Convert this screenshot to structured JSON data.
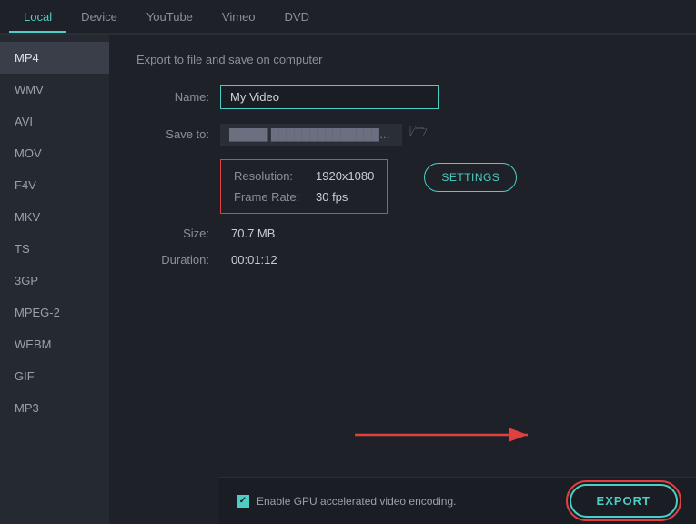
{
  "nav": {
    "tabs": [
      {
        "id": "local",
        "label": "Local",
        "active": true
      },
      {
        "id": "device",
        "label": "Device",
        "active": false
      },
      {
        "id": "youtube",
        "label": "YouTube",
        "active": false
      },
      {
        "id": "vimeo",
        "label": "Vimeo",
        "active": false
      },
      {
        "id": "dvd",
        "label": "DVD",
        "active": false
      }
    ]
  },
  "sidebar": {
    "formats": [
      {
        "id": "mp4",
        "label": "MP4",
        "active": true
      },
      {
        "id": "wmv",
        "label": "WMV",
        "active": false
      },
      {
        "id": "avi",
        "label": "AVI",
        "active": false
      },
      {
        "id": "mov",
        "label": "MOV",
        "active": false
      },
      {
        "id": "f4v",
        "label": "F4V",
        "active": false
      },
      {
        "id": "mkv",
        "label": "MKV",
        "active": false
      },
      {
        "id": "ts",
        "label": "TS",
        "active": false
      },
      {
        "id": "3gp",
        "label": "3GP",
        "active": false
      },
      {
        "id": "mpeg2",
        "label": "MPEG-2",
        "active": false
      },
      {
        "id": "webm",
        "label": "WEBM",
        "active": false
      },
      {
        "id": "gif",
        "label": "GIF",
        "active": false
      },
      {
        "id": "mp3",
        "label": "MP3",
        "active": false
      }
    ]
  },
  "content": {
    "section_title": "Export to file and save on computer",
    "name_label": "Name:",
    "name_value": "My Video",
    "save_to_label": "Save to:",
    "save_to_value": "C:/Users/Username/Videos",
    "resolution_label": "Resolution:",
    "resolution_value": "1920x1080",
    "frame_rate_label": "Frame Rate:",
    "frame_rate_value": "30 fps",
    "size_label": "Size:",
    "size_value": "70.7 MB",
    "duration_label": "Duration:",
    "duration_value": "00:01:12",
    "settings_button_label": "SETTINGS"
  },
  "bottom": {
    "gpu_label": "Enable GPU accelerated video encoding.",
    "export_label": "EXPORT"
  },
  "icons": {
    "folder": "📁",
    "checkbox_check": "✓"
  }
}
